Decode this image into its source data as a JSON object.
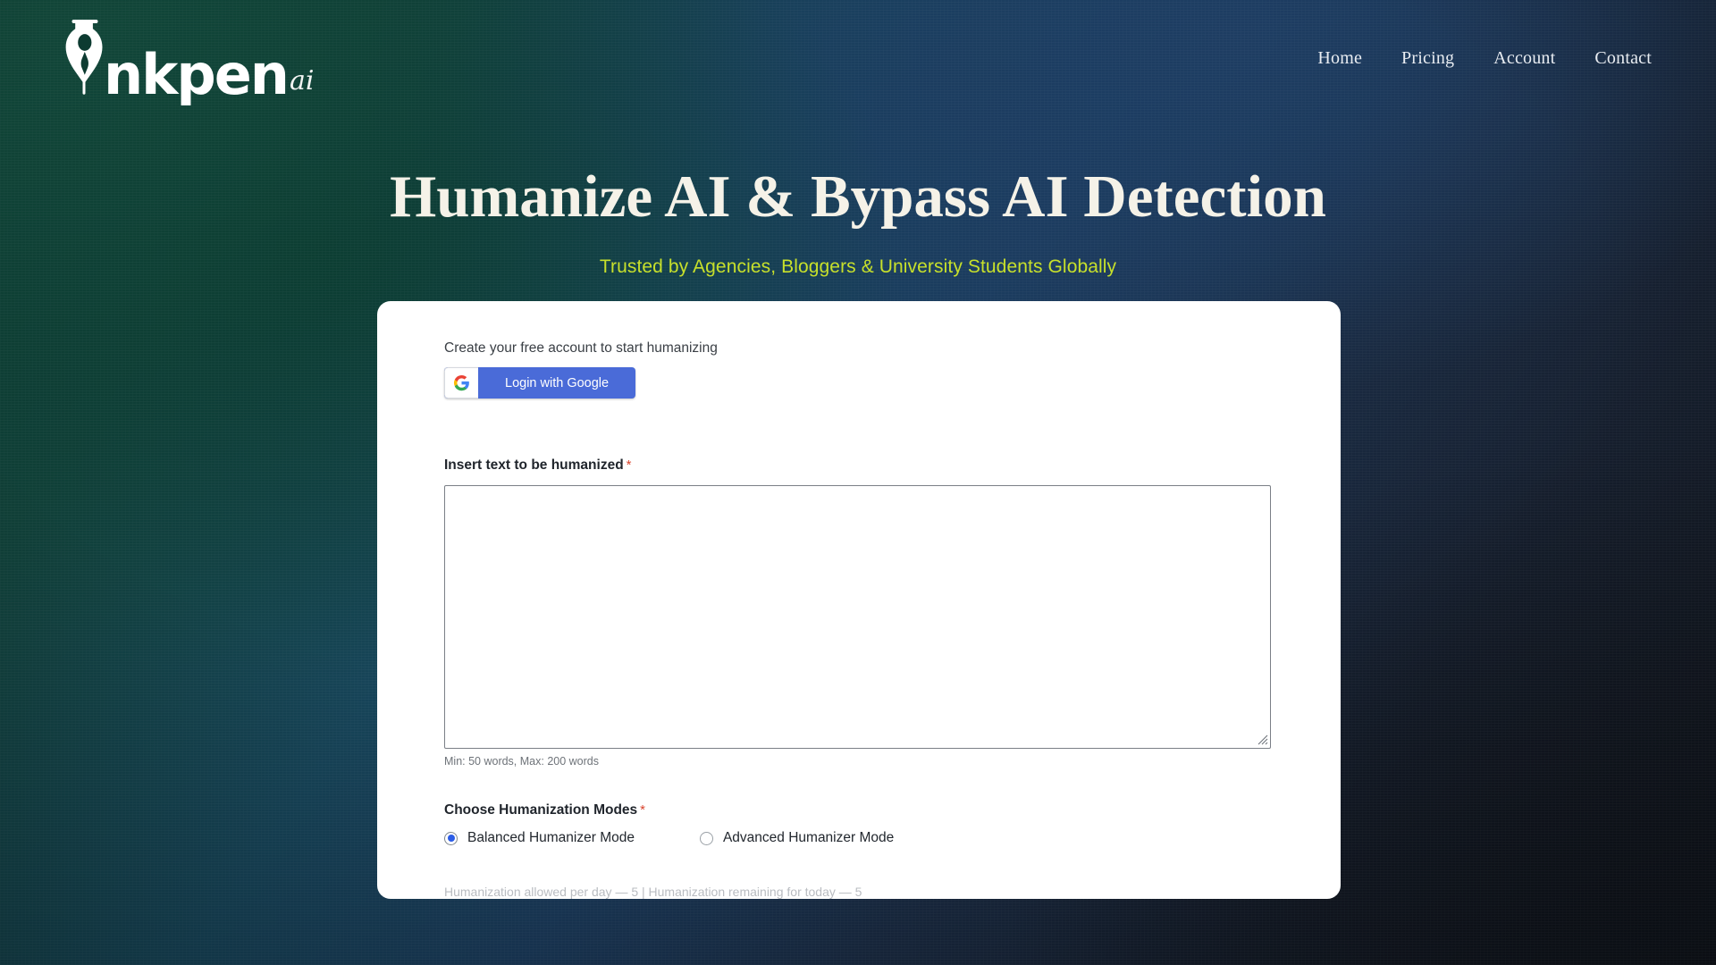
{
  "brand": {
    "word": "nkpen",
    "suffix": "ai",
    "nib_icon": "fountain-pen-nib-icon"
  },
  "nav": {
    "items": [
      {
        "label": "Home"
      },
      {
        "label": "Pricing"
      },
      {
        "label": "Account"
      },
      {
        "label": "Contact"
      }
    ]
  },
  "hero": {
    "headline": "Humanize AI & Bypass AI Detection",
    "tagline": "Trusted by Agencies, Bloggers & University Students Globally",
    "headline_color": "#f5f2e8",
    "tagline_color": "#c7e02b"
  },
  "card": {
    "account_prompt": "Create your free account to start humanizing",
    "google_button": {
      "label": "Login with Google",
      "icon": "google-g-icon",
      "bg_color": "#4a6bd8"
    },
    "textarea": {
      "label": "Insert text to be humanized",
      "required_marker": "*",
      "value": "",
      "placeholder": "",
      "hint": "Min: 50 words, Max: 200 words"
    },
    "modes": {
      "label": "Choose Humanization Modes",
      "required_marker": "*",
      "options": [
        {
          "label": "Balanced Humanizer Mode",
          "selected": true
        },
        {
          "label": "Advanced Humanizer Mode",
          "selected": false
        }
      ],
      "selected_color": "#2b5ce6"
    },
    "quota": "Humanization allowed per day — 5  |  Humanization remaining for today — 5"
  }
}
